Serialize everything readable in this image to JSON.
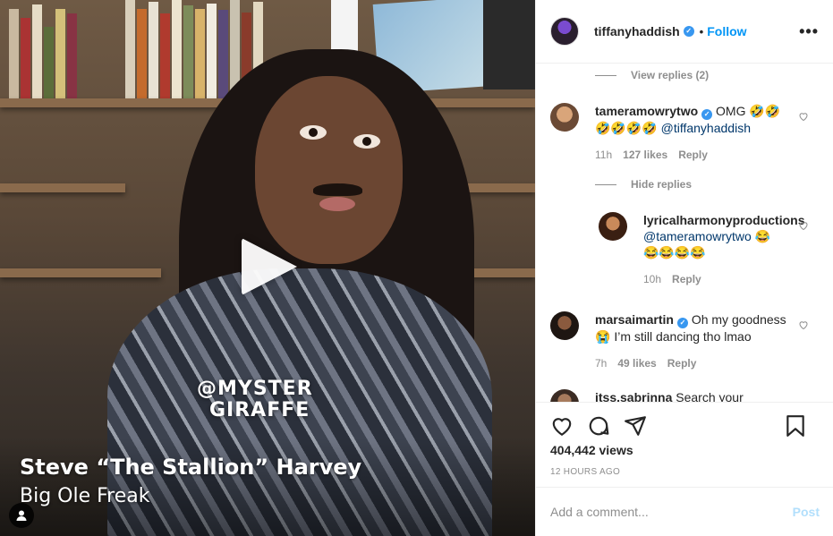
{
  "post": {
    "author": "tiffanyhaddish",
    "follow_label": "Follow",
    "separator": "•",
    "video": {
      "watermark_line1": "@MYSTER",
      "watermark_line2": "GIRAFFE",
      "caption_title": "Steve “The Stallion” Harvey",
      "caption_subtitle": "Big Ole Freak"
    },
    "views": "404,442 views",
    "time_ago": "12 HOURS AGO"
  },
  "comments": {
    "view_replies_label": "View replies (2)",
    "hide_replies_label": "Hide replies",
    "items": [
      {
        "username": "tameramowrytwo",
        "verified": true,
        "text": "OMG 🤣🤣",
        "text_line2": "🤣🤣🤣🤣",
        "mention": "@tiffanyhaddish",
        "time": "11h",
        "likes": "127 likes",
        "reply_label": "Reply"
      },
      {
        "username": "lyricalharmonyproductions",
        "verified": false,
        "mention": "@tameramowrytwo",
        "text": "😂",
        "text_line2": "😂😂😂😂",
        "time": "10h",
        "reply_label": "Reply"
      },
      {
        "username": "marsaimartin",
        "verified": true,
        "text": "Oh my goodness",
        "text_line2": "😭 I’m still dancing tho lmao",
        "time": "7h",
        "likes": "49 likes",
        "reply_label": "Reply"
      },
      {
        "username": "itss.sabrinna",
        "text": "Search your BF/GF's"
      }
    ]
  },
  "composer": {
    "placeholder": "Add a comment...",
    "post_label": "Post"
  },
  "icons": {
    "like": "heart-icon",
    "comment": "comment-icon",
    "share": "paper-plane-icon",
    "save": "bookmark-icon",
    "more": "more-options-icon",
    "tag": "user-tag-icon",
    "play": "play-icon"
  },
  "colors": {
    "link_blue": "#0095f6",
    "verified_blue": "#3897f0",
    "muted": "#8e8e8e",
    "post_disabled": "#b2dffc"
  }
}
